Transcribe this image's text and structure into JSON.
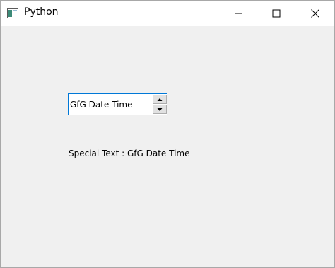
{
  "window": {
    "title": "Python",
    "controls": [
      "minimize-icon",
      "maximize-icon",
      "close-icon"
    ]
  },
  "datetime_edit": {
    "special_text": "GfG Date Time",
    "icons": [
      "arrow-up-icon",
      "arrow-down-icon"
    ]
  },
  "label": {
    "text": "Special Text : GfG Date Time"
  },
  "colors": {
    "focus_border": "#0078d7",
    "window_background": "#f0f0f0",
    "titlebar_background": "#ffffff"
  }
}
